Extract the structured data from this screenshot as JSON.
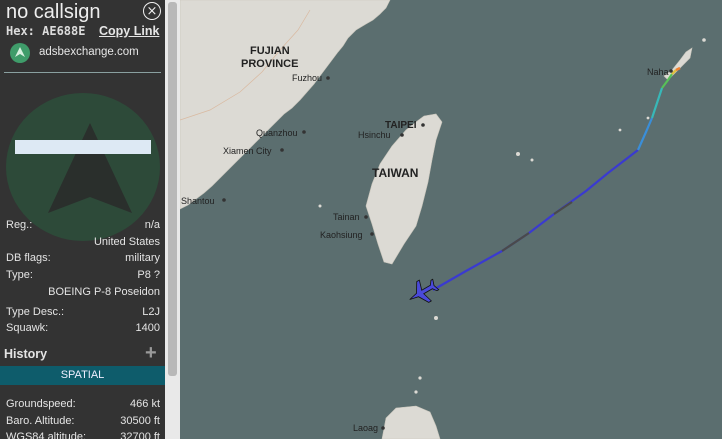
{
  "sidebar": {
    "callsign": "no callsign",
    "close_glyph": "⨯",
    "hex_label": "Hex: AE688E",
    "copy_link": "Copy Link",
    "source_site": "adsbexchange.com",
    "details": [
      {
        "key": "Reg.:",
        "value": "n/a"
      },
      {
        "key": "",
        "value": "United States"
      },
      {
        "key": "DB flags:",
        "value": "military"
      },
      {
        "key": "Type:",
        "value": "P8 ?"
      },
      {
        "key": "",
        "value": "BOEING P-8 Poseidon"
      },
      {
        "key": "Type Desc.:",
        "value": "L2J"
      },
      {
        "key": "Squawk:",
        "value": "1400"
      }
    ],
    "history_label": "History",
    "history_icon": "plus-icon",
    "spatial_tab": "SPATIAL",
    "flight": [
      {
        "key": "Groundspeed:",
        "value": "466 kt"
      },
      {
        "key": "Baro. Altitude:",
        "value": "30500 ft"
      },
      {
        "key": "WGS84 altitude:",
        "value": "32700 ft"
      }
    ]
  },
  "map": {
    "labels": {
      "fujian": "FUJIAN",
      "province": "PROVINCE",
      "fuzhou": "Fuzhou",
      "quanzhou": "Quanzhou",
      "xiamen": "Xiamen City",
      "shantou": "Shantou",
      "taipei": "TAIPEI",
      "hsinchu": "Hsinchu",
      "taiwan": "TAIWAN",
      "tainan": "Tainan",
      "kaohsiung": "Kaohsiung",
      "naha": "Naha",
      "laoag": "Laoag"
    },
    "colors": {
      "sea": "#5b6e6f",
      "land": "#dcdad4",
      "track_high": "#3a3ad0",
      "aircraft": "#4a4ad8"
    }
  }
}
